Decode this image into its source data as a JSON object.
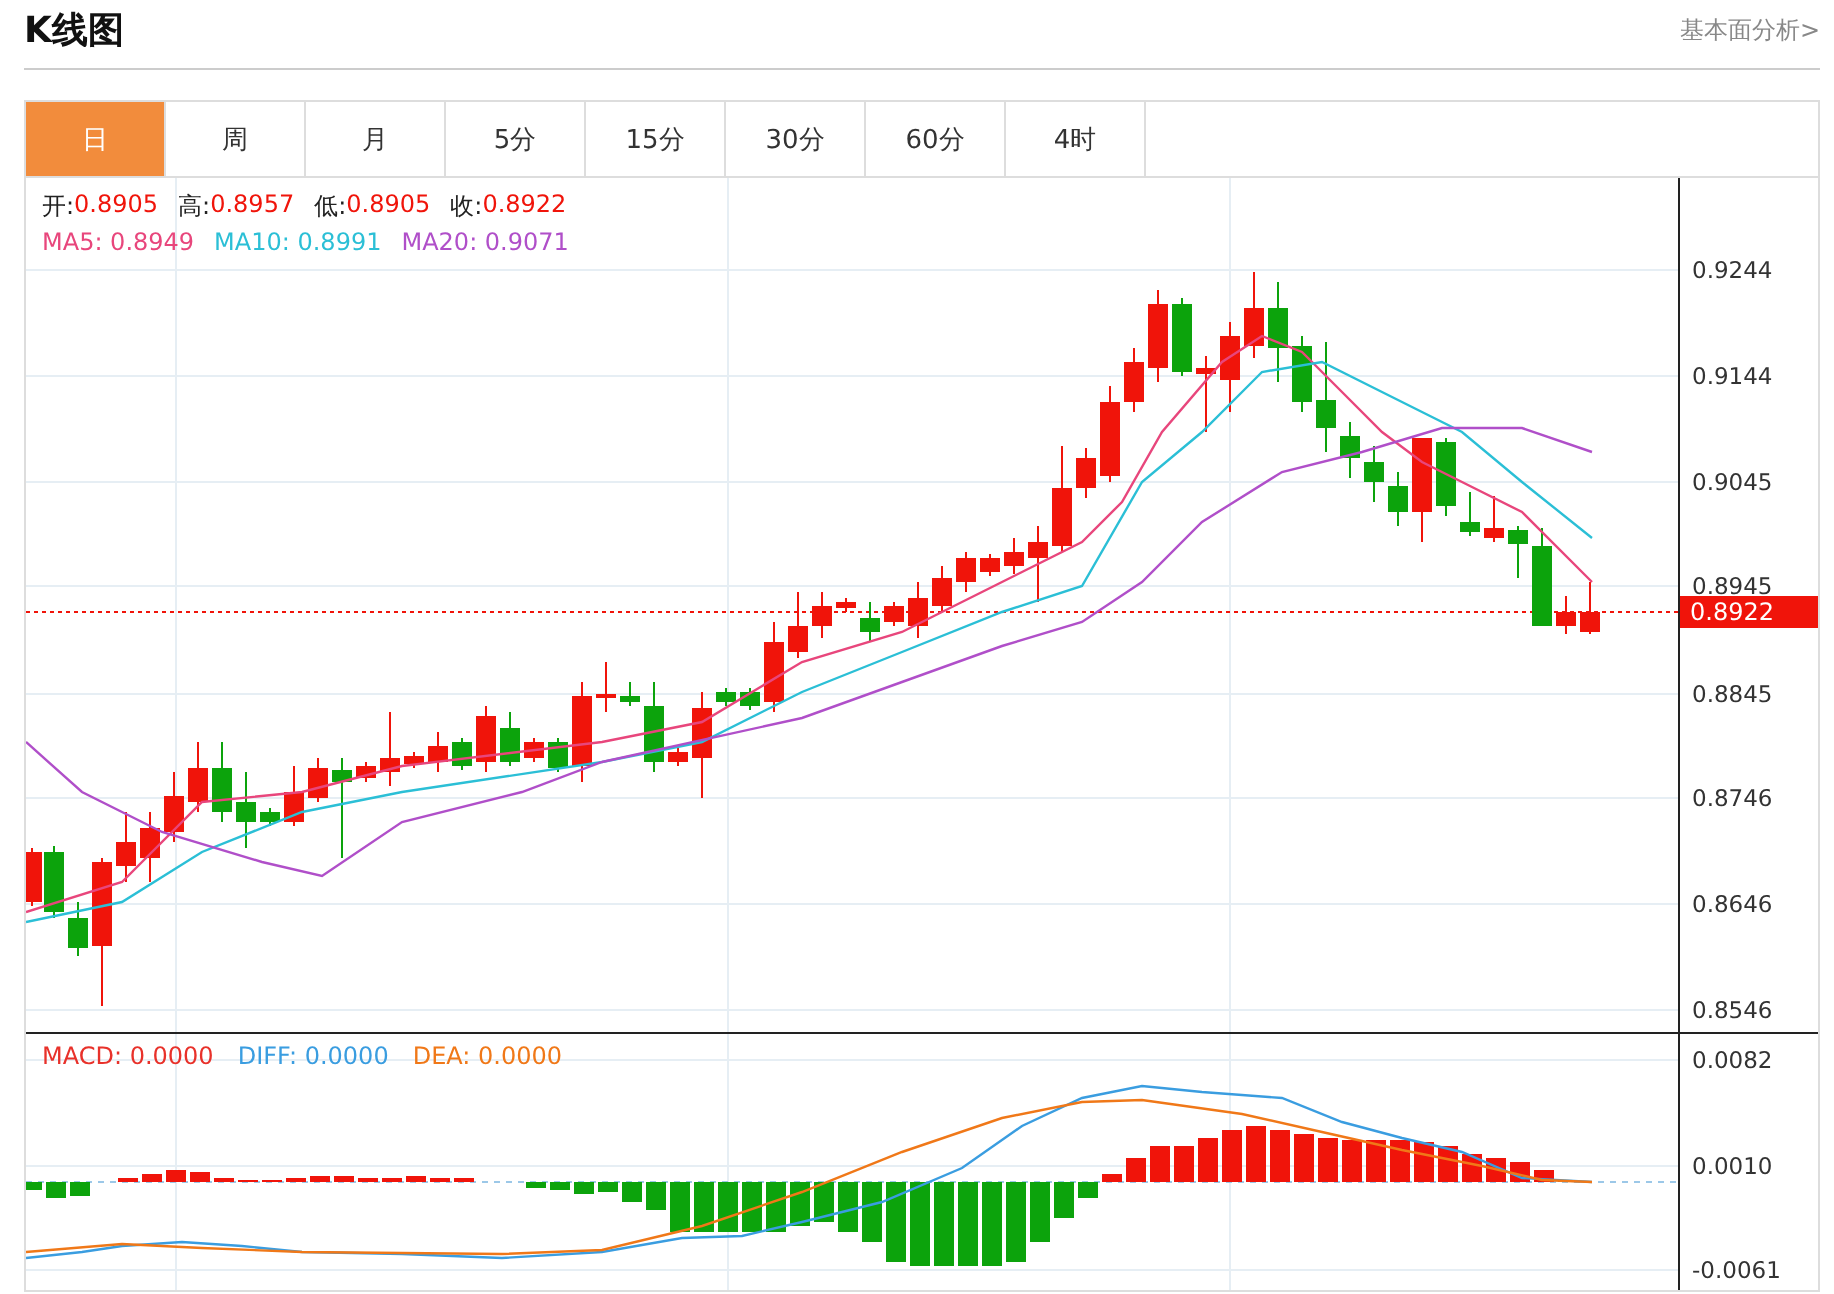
{
  "header": {
    "title": "K线图",
    "link": "基本面分析>"
  },
  "tabs": [
    {
      "label": "日",
      "selected": true
    },
    {
      "label": "周",
      "selected": false
    },
    {
      "label": "月",
      "selected": false
    },
    {
      "label": "5分",
      "selected": false
    },
    {
      "label": "15分",
      "selected": false
    },
    {
      "label": "30分",
      "selected": false
    },
    {
      "label": "60分",
      "selected": false
    },
    {
      "label": "4时",
      "selected": false
    }
  ],
  "ohlc": [
    {
      "label": "开:",
      "value": "0.8905"
    },
    {
      "label": "高:",
      "value": "0.8957"
    },
    {
      "label": "低:",
      "value": "0.8905"
    },
    {
      "label": "收:",
      "value": "0.8922"
    }
  ],
  "moving_averages": [
    {
      "label": "MA5: 0.8949",
      "color": "#e8467c"
    },
    {
      "label": "MA10: 0.8991",
      "color": "#2bbfd6"
    },
    {
      "label": "MA20: 0.9071",
      "color": "#b04fc9"
    }
  ],
  "price_axis": [
    "0.9244",
    "0.9144",
    "0.9045",
    "0.8945",
    "0.8845",
    "0.8746",
    "0.8646",
    "0.8546"
  ],
  "current_price": "0.8922",
  "macd_legend": [
    {
      "label": "MACD: 0.0000",
      "color": "#e8312a"
    },
    {
      "label": "DIFF: 0.0000",
      "color": "#3a9de0"
    },
    {
      "label": "DEA: 0.0000",
      "color": "#f07818"
    }
  ],
  "macd_axis": [
    "0.0082",
    "0.0010",
    "-0.0061"
  ]
}
